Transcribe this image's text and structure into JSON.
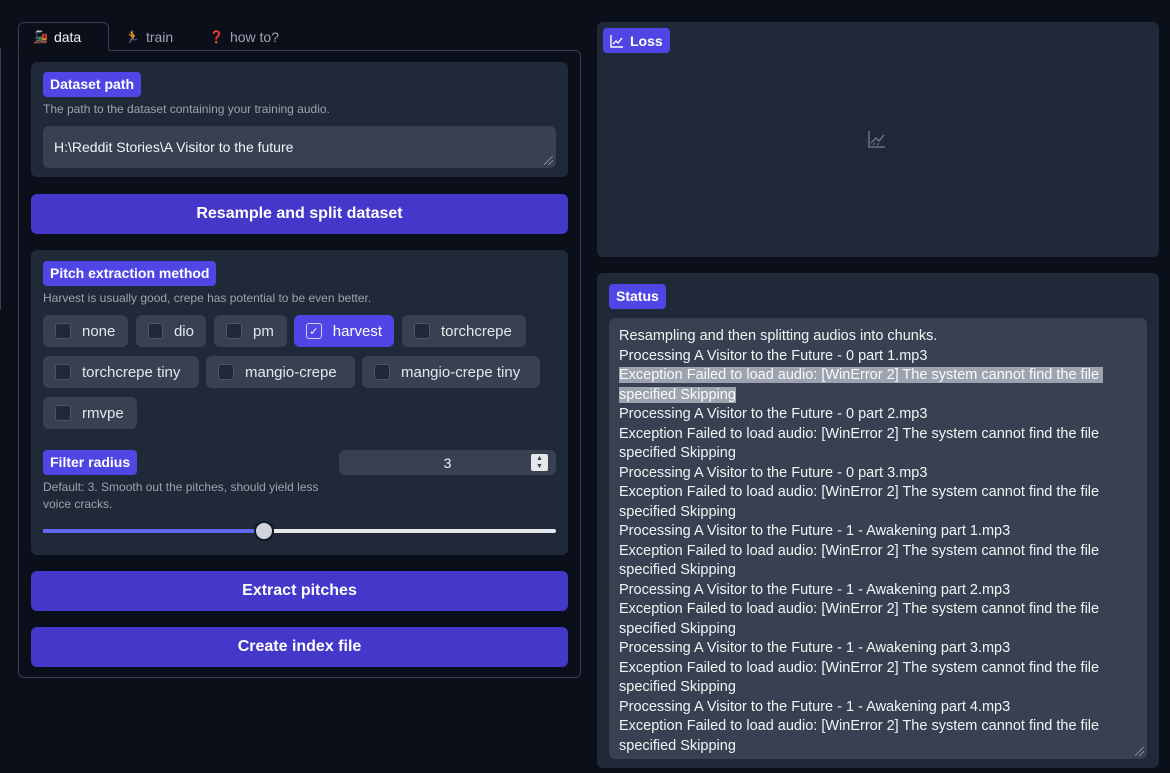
{
  "tabs": [
    {
      "icon": "🚂",
      "label": "data",
      "active": true
    },
    {
      "icon": "🏃",
      "label": "train",
      "active": false
    },
    {
      "icon": "❓",
      "label": "how to?",
      "active": false
    }
  ],
  "dataset": {
    "label": "Dataset path",
    "info": "The path to the dataset containing your training audio.",
    "value": "H:\\Reddit Stories\\A Visitor to the future"
  },
  "buttons": {
    "resample": "Resample and split dataset",
    "extract": "Extract pitches",
    "index": "Create index file"
  },
  "pitch": {
    "label": "Pitch extraction method",
    "info": "Harvest is usually good, crepe has potential to be even better.",
    "options": [
      {
        "label": "none",
        "checked": false
      },
      {
        "label": "dio",
        "checked": false
      },
      {
        "label": "pm",
        "checked": false
      },
      {
        "label": "harvest",
        "checked": true
      },
      {
        "label": "torchcrepe",
        "checked": false
      },
      {
        "label": "torchcrepe tiny",
        "checked": false
      },
      {
        "label": "mangio-crepe",
        "checked": false
      },
      {
        "label": "mangio-crepe tiny",
        "checked": false
      },
      {
        "label": "rmvpe",
        "checked": false
      }
    ]
  },
  "filter": {
    "label": "Filter radius",
    "info": "Default: 3. Smooth out the pitches, should yield less voice cracks.",
    "value": "3",
    "slider_fraction": 0.43
  },
  "plot": {
    "label": "Loss"
  },
  "status": {
    "label": "Status",
    "lines": [
      "Resampling and then splitting audios into chunks.",
      "Processing A Visitor to the Future - 0 part 1.mp3",
      "Exception Failed to load audio: [WinError 2] The system cannot find the file specified Skipping",
      "Processing A Visitor to the Future - 0 part 2.mp3",
      "Exception Failed to load audio: [WinError 2] The system cannot find the file specified Skipping",
      "Processing A Visitor to the Future - 0 part 3.mp3",
      "Exception Failed to load audio: [WinError 2] The system cannot find the file specified Skipping",
      "Processing A Visitor to the Future - 1 - Awakening part 1.mp3",
      "Exception Failed to load audio: [WinError 2] The system cannot find the file specified Skipping",
      "Processing A Visitor to the Future - 1 - Awakening part 2.mp3",
      "Exception Failed to load audio: [WinError 2] The system cannot find the file specified Skipping",
      "Processing A Visitor to the Future - 1 - Awakening part 3.mp3",
      "Exception Failed to load audio: [WinError 2] The system cannot find the file specified Skipping",
      "Processing A Visitor to the Future - 1 - Awakening part 4.mp3",
      "Exception Failed to load audio: [WinError 2] The system cannot find the file specified Skipping"
    ]
  }
}
